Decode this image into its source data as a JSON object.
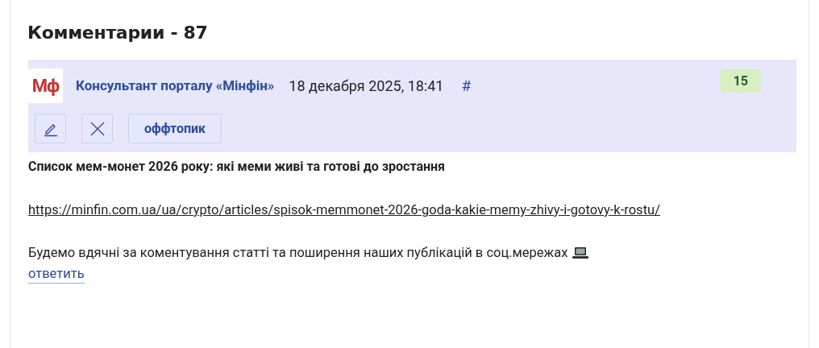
{
  "heading": "Комментарии - 87",
  "comment": {
    "avatar": "Мф",
    "author": "Консультант порталу «Мінфін»",
    "date": "18 декабря 2025, 18:41",
    "anchor": "#",
    "rating": "15",
    "actions": [
      {
        "kind": "edit"
      },
      {
        "kind": "delete"
      },
      {
        "kind": "text",
        "label": "оффтопик"
      }
    ],
    "title": "Список мем-монет 2026 року: які меми живі та готові до зростання",
    "link": "https://minfin.com.ua/ua/crypto/articles/spisok-memmonet-2026-goda-kakie-memy-zhivy-i-gotovy-k-rostu/",
    "text": "Будемо вдячні за коментування статті та поширення наших публікацій в соц.мережах",
    "reply": "ответить"
  }
}
